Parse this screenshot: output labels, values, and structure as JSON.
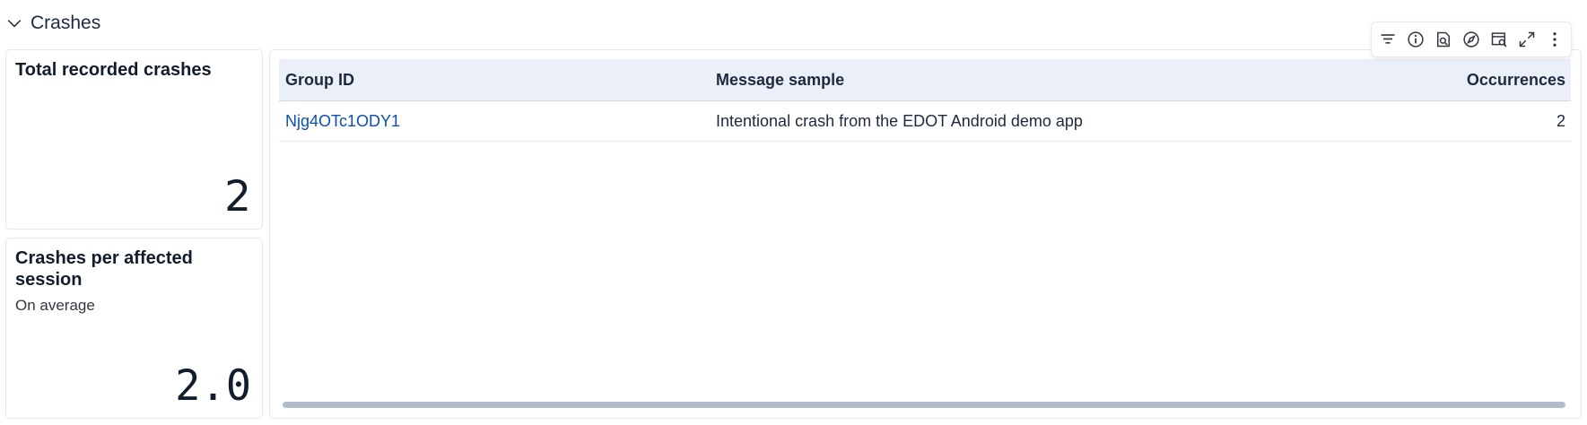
{
  "section": {
    "title": "Crashes"
  },
  "metrics": {
    "total": {
      "title": "Total recorded crashes",
      "value": "2"
    },
    "per_session": {
      "title": "Crashes per affected session",
      "subtitle": "On average",
      "value": "2.0"
    }
  },
  "table": {
    "columns": [
      "Group ID",
      "Message sample",
      "Occurrences"
    ],
    "rows": [
      {
        "group_id": "Njg4OTc1ODY1",
        "message": "Intentional crash from the EDOT Android demo app",
        "occurrences": "2"
      }
    ]
  },
  "toolbar": {
    "icons": [
      "filter-icon",
      "info-icon",
      "inspect-icon",
      "explore-icon",
      "discover-icon",
      "maximize-icon",
      "more-options-icon"
    ]
  }
}
